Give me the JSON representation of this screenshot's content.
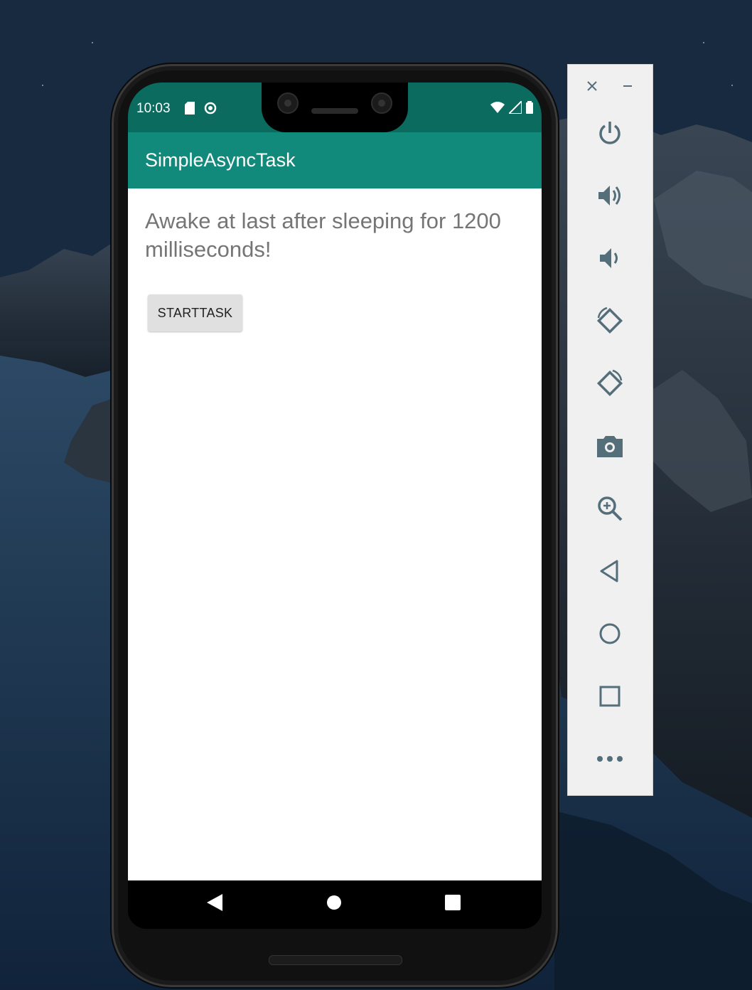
{
  "status_bar": {
    "time": "10:03",
    "left_icons": [
      "sd-card-icon",
      "sync-icon"
    ],
    "right_icons": [
      "wifi-icon",
      "signal-icon",
      "battery-icon"
    ]
  },
  "app_bar": {
    "title": "SimpleAsyncTask"
  },
  "content": {
    "message": "Awake at last after sleeping for 1200 milliseconds!",
    "start_button_label": "STARTTASK"
  },
  "nav_bar": {
    "buttons": [
      "back-icon",
      "home-icon",
      "recents-icon"
    ]
  },
  "emulator_toolbar": {
    "window_controls": [
      "close-icon",
      "minimize-icon"
    ],
    "buttons": [
      "power-icon",
      "volume-up-icon",
      "volume-down-icon",
      "rotate-left-icon",
      "rotate-right-icon",
      "camera-icon",
      "zoom-icon",
      "back-icon",
      "home-icon",
      "overview-icon",
      "more-icon"
    ]
  },
  "colors": {
    "status_bar": "#0b6b5f",
    "app_bar": "#128a7b",
    "message_text": "#757575",
    "button_bg": "#e0e0e0",
    "toolbar_bg": "#f0f0f0",
    "toolbar_icon": "#546e7a"
  }
}
